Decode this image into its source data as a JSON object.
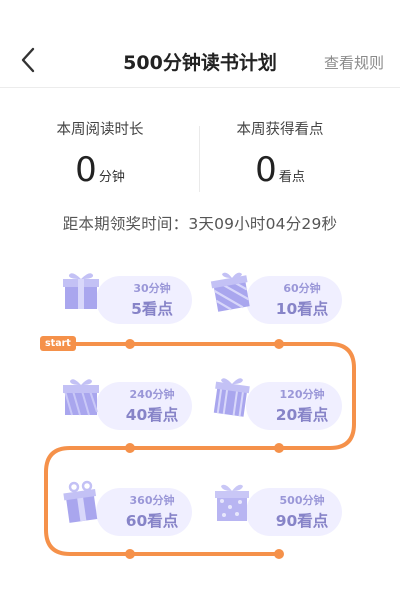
{
  "header": {
    "title": "500分钟读书计划",
    "rules_label": "查看规则"
  },
  "stats": {
    "read_label": "本周阅读时长",
    "read_value": "0",
    "read_unit": "分钟",
    "points_label": "本周获得看点",
    "points_value": "0",
    "points_unit": "看点"
  },
  "countdown": "距本期领奖时间：3天09小时04分29秒",
  "map": {
    "start_label": "start",
    "track_color": "#f5914a",
    "rewards": [
      {
        "minutes": "30分钟",
        "points": "5看点"
      },
      {
        "minutes": "60分钟",
        "points": "10看点"
      },
      {
        "minutes": "120分钟",
        "points": "20看点"
      },
      {
        "minutes": "240分钟",
        "points": "40看点"
      },
      {
        "minutes": "360分钟",
        "points": "60看点"
      },
      {
        "minutes": "500分钟",
        "points": "90看点"
      }
    ]
  }
}
